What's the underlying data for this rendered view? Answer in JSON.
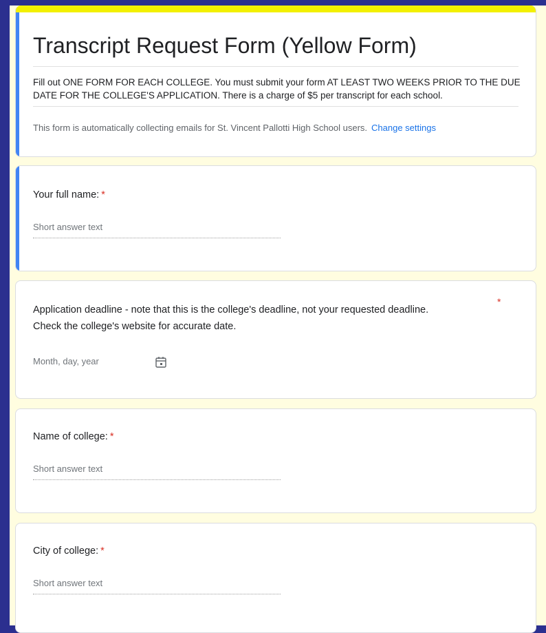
{
  "form": {
    "title": "Transcript Request Form (Yellow Form)",
    "description": "Fill out ONE FORM FOR EACH COLLEGE. You must submit your form AT LEAST TWO WEEKS PRIOR TO THE DUE DATE FOR THE COLLEGE'S APPLICATION. There is a charge of $5 per transcript for each school.",
    "email_notice": "This form is automatically collecting emails for St. Vincent Pallotti High School users.",
    "change_settings_label": "Change settings"
  },
  "questions": [
    {
      "label": "Your full name:",
      "required_mark": "*",
      "placeholder": "Short answer text"
    },
    {
      "label_line1": "Application deadline - note that this is the college's deadline, not your requested deadline.",
      "label_line2": "Check the college's website for accurate date.",
      "required_mark": "*",
      "placeholder": "Month, day, year",
      "icon": "calendar-icon"
    },
    {
      "label": "Name of college:",
      "required_mark": "*",
      "placeholder": "Short answer text"
    },
    {
      "label": "City of college:",
      "required_mark": "*",
      "placeholder": "Short answer text"
    }
  ],
  "colors": {
    "accent": "#4285f4",
    "header_bar": "#f3f000",
    "page_background": "#fffde0",
    "outer_border": "#2b2f8f",
    "required": "#d93025",
    "link": "#1a73e8"
  }
}
